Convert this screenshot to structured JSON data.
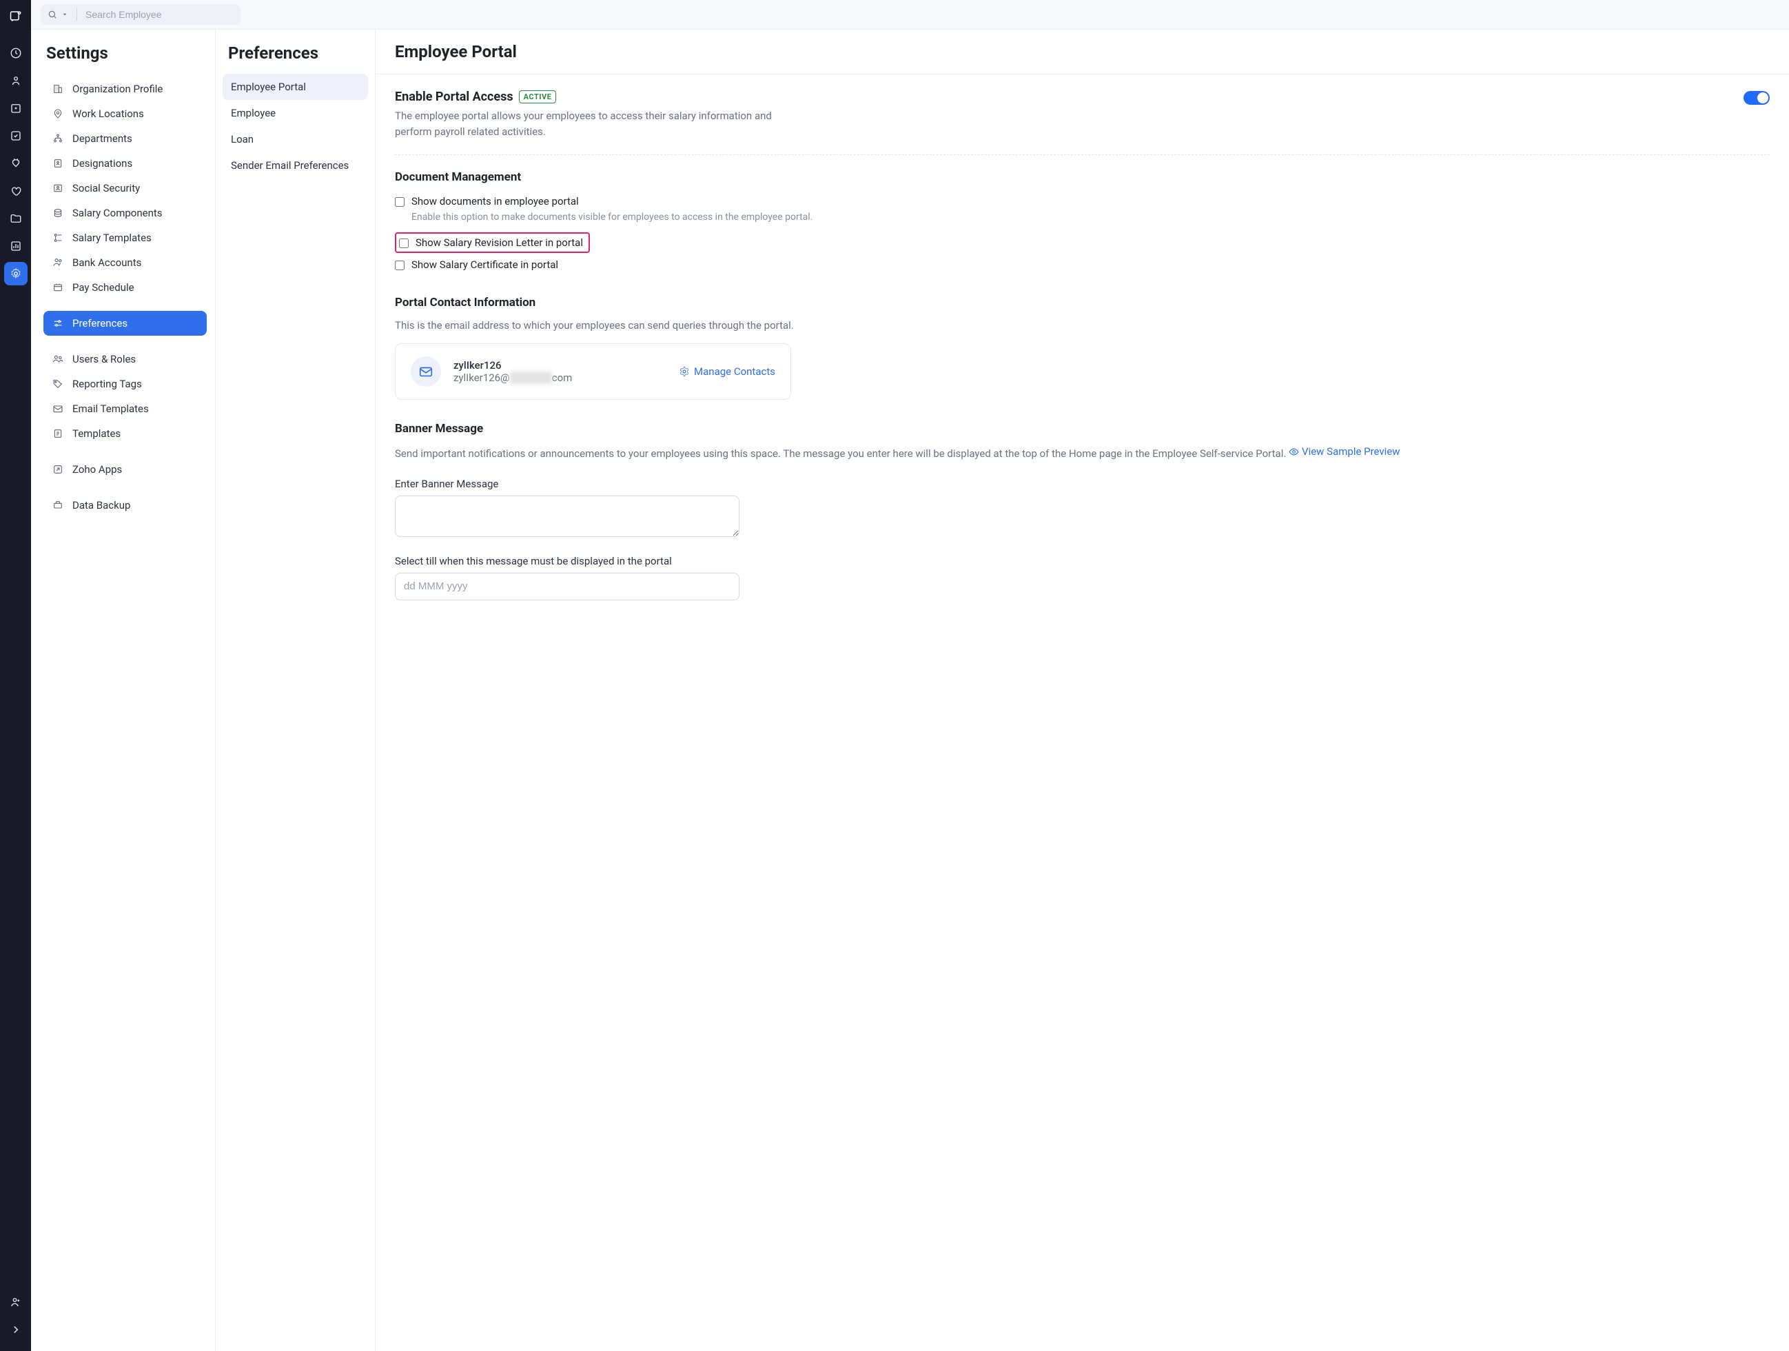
{
  "search": {
    "placeholder": "Search Employee"
  },
  "settings": {
    "title": "Settings",
    "items": [
      "Organization Profile",
      "Work Locations",
      "Departments",
      "Designations",
      "Social Security",
      "Salary Components",
      "Salary Templates",
      "Bank Accounts",
      "Pay Schedule",
      "Preferences",
      "Users & Roles",
      "Reporting Tags",
      "Email Templates",
      "Templates",
      "Zoho Apps",
      "Data Backup"
    ]
  },
  "prefs": {
    "title": "Preferences",
    "items": [
      "Employee Portal",
      "Employee",
      "Loan",
      "Sender Email Preferences"
    ]
  },
  "content": {
    "title": "Employee Portal",
    "enable": {
      "heading": "Enable Portal Access",
      "badge": "ACTIVE",
      "desc": "The employee portal allows your employees to access their salary information and perform payroll related activities."
    },
    "doc": {
      "heading": "Document Management",
      "c1": "Show documents in employee portal",
      "c1sub": "Enable this option to make documents visible for employees to access in the employee portal.",
      "c2": "Show Salary Revision Letter in portal",
      "c3": "Show Salary Certificate in portal"
    },
    "contact": {
      "heading": "Portal Contact Information",
      "desc": "This is the email address to which your employees can send queries through the portal.",
      "name": "zylIker126",
      "email_pre": "zylIker126@",
      "email_hidden": "xxxxx",
      "email_post": "com",
      "manage": "Manage Contacts"
    },
    "banner": {
      "heading": "Banner Message",
      "desc": "Send important notifications or announcements to your employees using this space. The message you enter here will be displayed at the top of the Home page in the Employee Self-service Portal.",
      "preview_link": "View Sample Preview",
      "input_label": "Enter Banner Message",
      "date_label": "Select till when this message must be displayed in the portal",
      "date_placeholder": "dd MMM yyyy"
    }
  }
}
